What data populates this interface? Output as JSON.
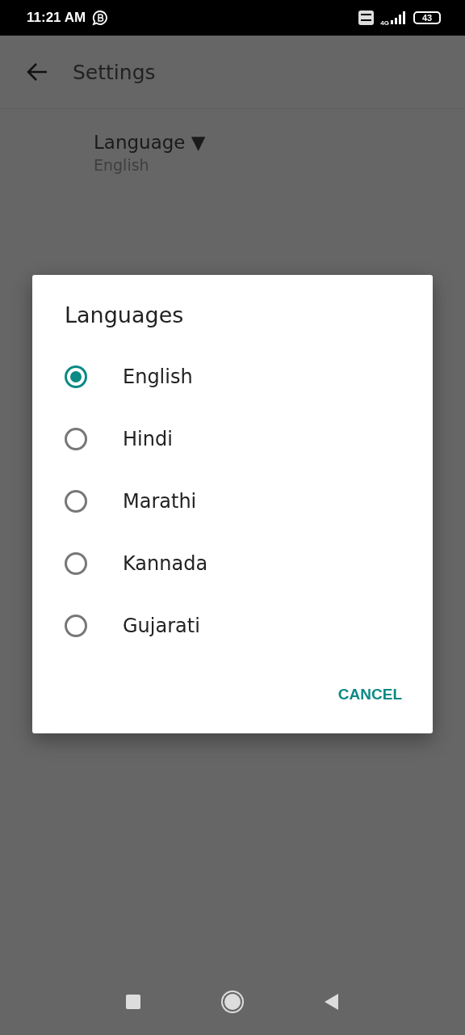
{
  "status_bar": {
    "time": "11:21 AM",
    "network": "4G",
    "battery": "43"
  },
  "app_bar": {
    "title": "Settings"
  },
  "setting": {
    "title": "Language ▼",
    "value": "English"
  },
  "dialog": {
    "title": "Languages",
    "options": [
      {
        "label": "English",
        "selected": true
      },
      {
        "label": "Hindi",
        "selected": false
      },
      {
        "label": "Marathi",
        "selected": false
      },
      {
        "label": "Kannada",
        "selected": false
      },
      {
        "label": "Gujarati",
        "selected": false
      }
    ],
    "buttons": [
      "CANCEL"
    ]
  }
}
